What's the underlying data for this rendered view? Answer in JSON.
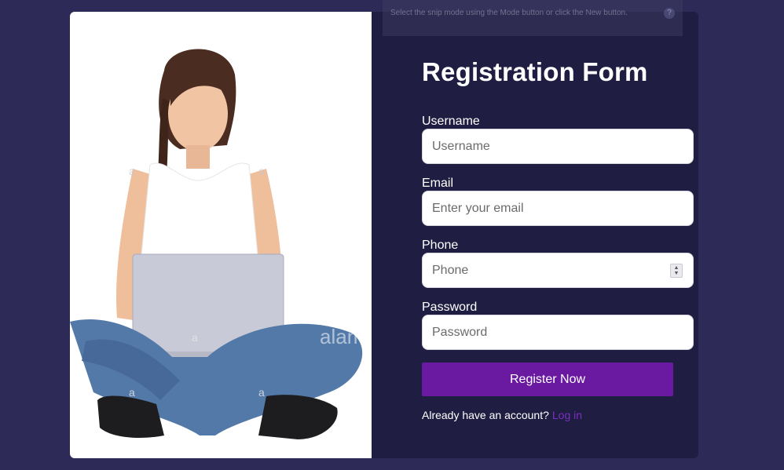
{
  "form": {
    "title": "Registration Form",
    "fields": {
      "username": {
        "label": "Username",
        "placeholder": "Username"
      },
      "email": {
        "label": "Email",
        "placeholder": "Enter your email"
      },
      "phone": {
        "label": "Phone",
        "placeholder": "Phone"
      },
      "password": {
        "label": "Password",
        "placeholder": "Password"
      }
    },
    "submit_label": "Register Now",
    "login_prompt": "Already have an account?",
    "login_link": "Log in"
  },
  "overlay": {
    "tooltip_text": "Select the snip mode using the Mode button or click the New button.",
    "help_icon": "?"
  },
  "photo": {
    "watermark": "alamy",
    "watermark_letter": "a"
  },
  "colors": {
    "page_background": "#2e2a58",
    "form_background": "#201d42",
    "button": "#6a1aa0",
    "link": "#7b2fbf"
  }
}
